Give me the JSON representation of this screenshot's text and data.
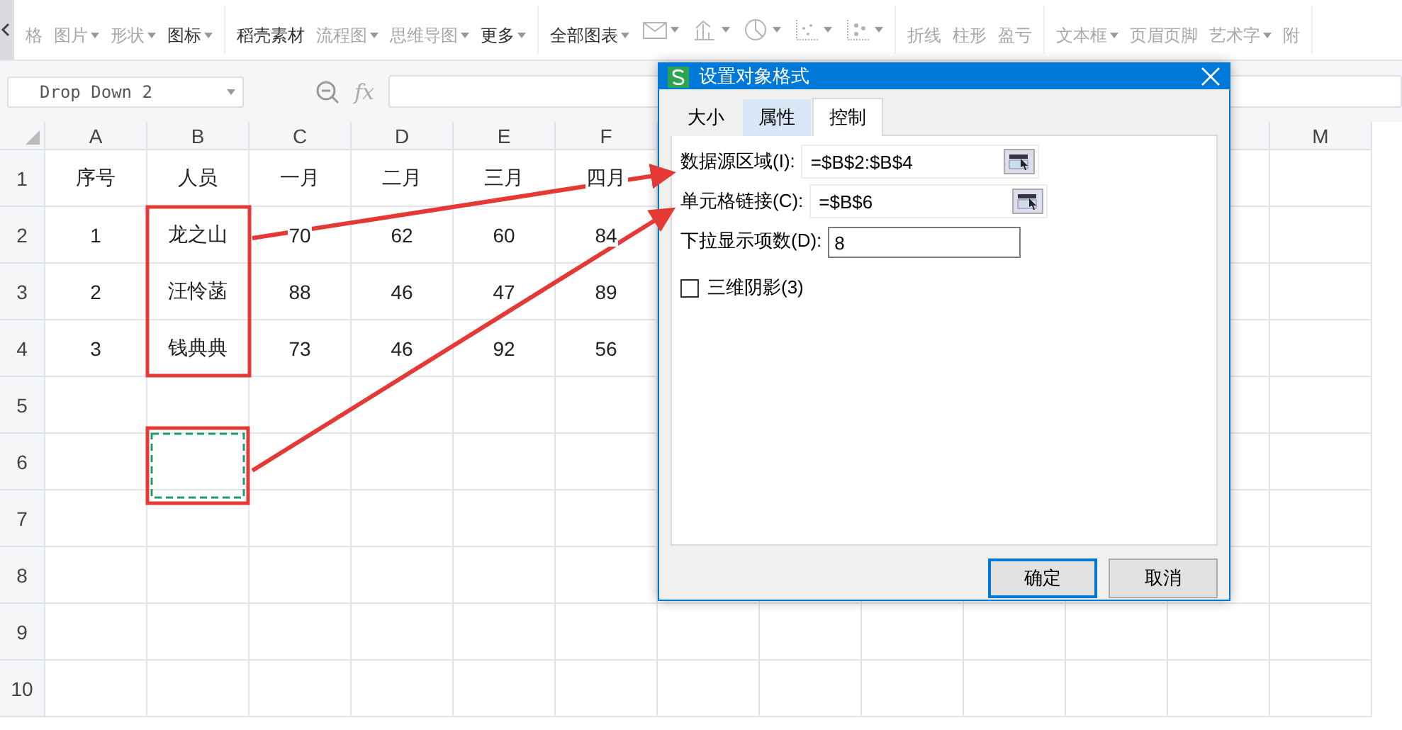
{
  "toolbar": {
    "groups": [
      {
        "items": [
          {
            "label": "格",
            "dropdown": false,
            "disabled": true
          },
          {
            "label": "图片",
            "dropdown": true,
            "disabled": true
          },
          {
            "label": "形状",
            "dropdown": true,
            "disabled": true
          },
          {
            "label": "图标",
            "dropdown": true,
            "disabled": false
          }
        ]
      },
      {
        "items": [
          {
            "label": "稻壳素材",
            "dropdown": false,
            "disabled": false
          },
          {
            "label": "流程图",
            "dropdown": true,
            "disabled": true
          },
          {
            "label": "思维导图",
            "dropdown": true,
            "disabled": true
          },
          {
            "label": "更多",
            "dropdown": true,
            "disabled": false
          }
        ]
      },
      {
        "kind": "chart",
        "items": [
          {
            "label": "全部图表",
            "dropdown": true,
            "disabled": false
          }
        ]
      },
      {
        "items": [
          {
            "label": "折线",
            "dropdown": false,
            "disabled": true
          },
          {
            "label": "柱形",
            "dropdown": false,
            "disabled": true
          },
          {
            "label": "盈亏",
            "dropdown": false,
            "disabled": true
          }
        ]
      },
      {
        "items": [
          {
            "label": "文本框",
            "dropdown": true,
            "disabled": true
          },
          {
            "label": "页眉页脚",
            "dropdown": false,
            "disabled": true
          },
          {
            "label": "艺术字",
            "dropdown": true,
            "disabled": true
          },
          {
            "label": "附",
            "dropdown": false,
            "disabled": true
          }
        ]
      }
    ]
  },
  "name_box": "Drop Down 2",
  "formula_label": "fx",
  "sheet": {
    "columns": [
      "A",
      "B",
      "C",
      "D",
      "E",
      "F"
    ],
    "right_columns": [
      "M"
    ],
    "row_numbers": [
      "1",
      "2",
      "3",
      "4",
      "5",
      "6",
      "7",
      "8",
      "9",
      "10"
    ],
    "rows": [
      [
        "序号",
        "人员",
        "一月",
        "二月",
        "三月",
        "四月"
      ],
      [
        "1",
        "龙之山",
        "70",
        "62",
        "60",
        "84"
      ],
      [
        "2",
        "汪怜菡",
        "88",
        "46",
        "47",
        "89"
      ],
      [
        "3",
        "钱典典",
        "73",
        "46",
        "92",
        "56"
      ]
    ]
  },
  "dialog": {
    "title": "设置对象格式",
    "tabs": [
      {
        "label": "大小",
        "selected": false
      },
      {
        "label": "属性",
        "selected": false
      },
      {
        "label": "控制",
        "selected": true
      }
    ],
    "fields": [
      {
        "kind": "range",
        "label": "数据源区域(I):",
        "value": "=$B$2:$B$4"
      },
      {
        "kind": "range",
        "label": "单元格链接(C):",
        "value": "=$B$6"
      },
      {
        "kind": "text",
        "label": "下拉显示项数(D):",
        "value": "8"
      }
    ],
    "checkbox": {
      "label": "三维阴影(3)",
      "checked": false
    },
    "buttons": [
      {
        "label": "确定",
        "default": true
      },
      {
        "label": "取消",
        "default": false
      }
    ]
  }
}
